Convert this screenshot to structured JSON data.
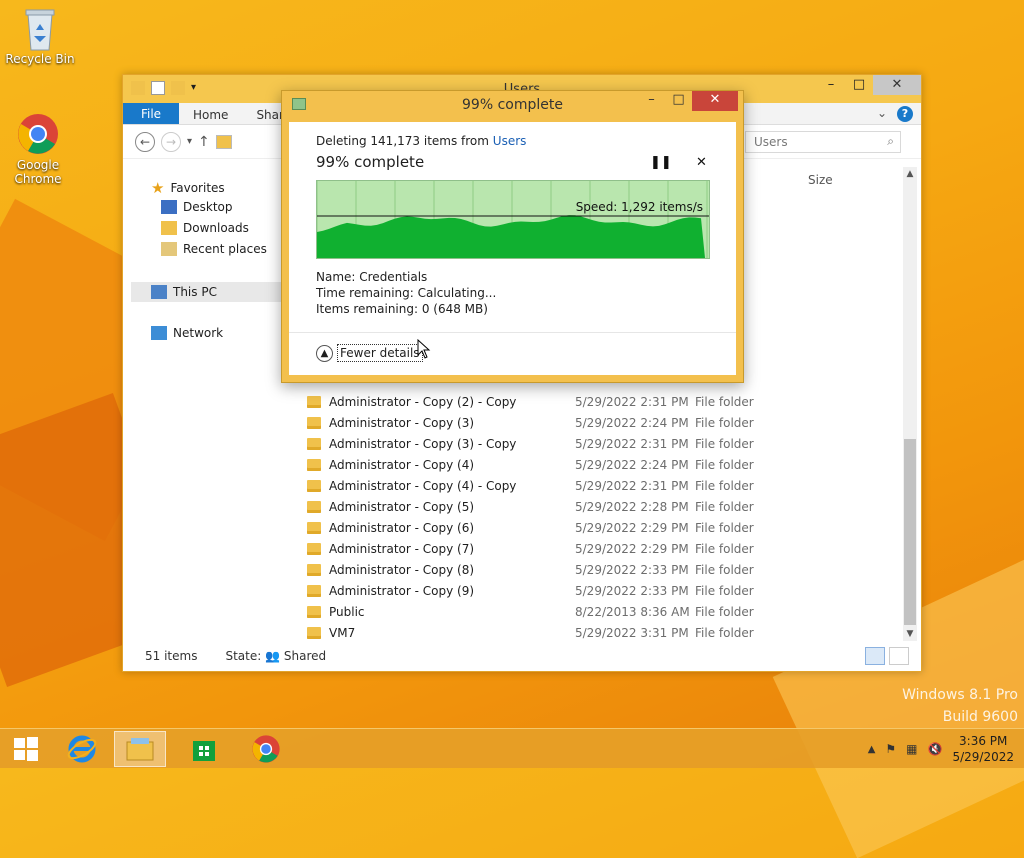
{
  "desktop": {
    "icons": [
      {
        "label": "Recycle Bin",
        "icon": "recycle-bin-icon"
      },
      {
        "label": "Google Chrome",
        "icon": "chrome-icon"
      }
    ],
    "watermark_line1": "Windows 8.1 Pro",
    "watermark_line2": "Build 9600"
  },
  "explorer": {
    "title": "Users",
    "ribbon_tabs": [
      "File",
      "Home",
      "Shar"
    ],
    "search_placeholder": "Users",
    "nav": {
      "favorites": "Favorites",
      "desktop": "Desktop",
      "downloads": "Downloads",
      "recent": "Recent places",
      "thispc": "This PC",
      "network": "Network"
    },
    "size_header": "Size",
    "rows": [
      {
        "name": "Administrator - Copy (2) - Copy",
        "date": "5/29/2022 2:31 PM",
        "type": "File folder"
      },
      {
        "name": "Administrator - Copy (3)",
        "date": "5/29/2022 2:24 PM",
        "type": "File folder"
      },
      {
        "name": "Administrator - Copy (3) - Copy",
        "date": "5/29/2022 2:31 PM",
        "type": "File folder"
      },
      {
        "name": "Administrator - Copy (4)",
        "date": "5/29/2022 2:24 PM",
        "type": "File folder"
      },
      {
        "name": "Administrator - Copy (4) - Copy",
        "date": "5/29/2022 2:31 PM",
        "type": "File folder"
      },
      {
        "name": "Administrator - Copy (5)",
        "date": "5/29/2022 2:28 PM",
        "type": "File folder"
      },
      {
        "name": "Administrator - Copy (6)",
        "date": "5/29/2022 2:29 PM",
        "type": "File folder"
      },
      {
        "name": "Administrator - Copy (7)",
        "date": "5/29/2022 2:29 PM",
        "type": "File folder"
      },
      {
        "name": "Administrator - Copy (8)",
        "date": "5/29/2022 2:33 PM",
        "type": "File folder"
      },
      {
        "name": "Administrator - Copy (9)",
        "date": "5/29/2022 2:33 PM",
        "type": "File folder"
      },
      {
        "name": "Public",
        "date": "8/22/2013 8:36 AM",
        "type": "File folder"
      },
      {
        "name": "VM7",
        "date": "5/29/2022 3:31 PM",
        "type": "File folder"
      }
    ],
    "status_count": "51 items",
    "status_state_label": "State:",
    "status_state_value": "Shared"
  },
  "dialog": {
    "title": "99% complete",
    "deleting_prefix": "Deleting 141,173 items from",
    "deleting_link": "Users",
    "percent": "99% complete",
    "percent_value": 0.99,
    "speed": "Speed: 1,292 items/s",
    "name": "Name:  Credentials",
    "time_remaining": "Time remaining:  Calculating...",
    "items_remaining": "Items remaining:  0 (648 MB)",
    "fewer_details": "Fewer details",
    "graph_color": "#10b030"
  },
  "taskbar": {
    "time": "3:36 PM",
    "date": "5/29/2022"
  }
}
